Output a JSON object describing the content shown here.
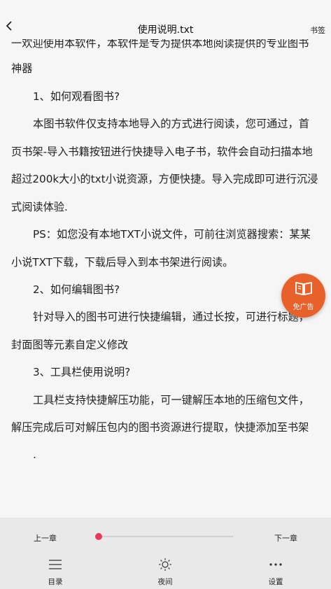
{
  "header": {
    "title": "使用说明.txt",
    "bookmark_label": "书签"
  },
  "content": {
    "lines": [
      "一欢迎使用本软件，本软件是专为提供本地阅读提供的专业图书",
      "神器",
      "1、如何观看图书?",
      "本图书软件仅支持本地导入的方式进行阅读，您可通过，首",
      "页书架-导入书籍按钮进行快捷导入电子书，软件会自动扫描本地",
      "超过200k大小的txt小说资源，方便快捷。导入完成即可进行沉浸",
      "式阅读体验.",
      "PS：如您没有本地TXT小说文件，可前往浏览器搜索：某某",
      "小说TXT下载，下载后导入到本书架进行阅读。",
      "2、如何编辑图书?",
      "针对导入的图书可进行快捷编辑，通过长按，可进行标题，",
      "封面图等元素自定义修改",
      "3、工具栏使用说明?",
      "工具栏支持快捷解压功能，可一键解压本地的压缩包文件，",
      "解压完成后可对解压包内的图书资源进行提取，快捷添加至书架",
      "."
    ]
  },
  "fab": {
    "label": "免广告",
    "icon": "book-icon",
    "color": "#e8612a"
  },
  "bottom_bar": {
    "prev_chapter": "上一章",
    "next_chapter": "下一章",
    "progress": 0.0,
    "slider_color": "#e8375a",
    "tools": [
      {
        "label": "目录",
        "icon": "list-icon"
      },
      {
        "label": "夜间",
        "icon": "sun-icon"
      },
      {
        "label": "设置",
        "icon": "more-dots-icon"
      }
    ]
  }
}
